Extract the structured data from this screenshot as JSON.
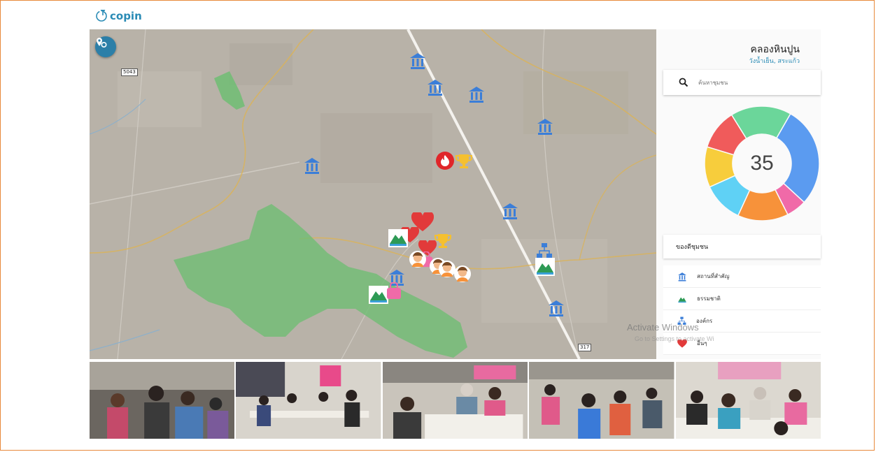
{
  "app": {
    "name": "copin"
  },
  "map": {
    "road_badges": [
      "5043",
      "317"
    ]
  },
  "panel": {
    "title": "คลองหินปูน",
    "subtitle": "วังน้ำเย็น, สระแก้ว",
    "search": {
      "placeholder": "ค้นหาชุมชน"
    },
    "donut": {
      "total": "35",
      "segments": [
        {
          "color": "#5b9bf0",
          "value": 10
        },
        {
          "color": "#f06aa8",
          "value": 2
        },
        {
          "color": "#f7923a",
          "value": 5
        },
        {
          "color": "#5fd1f5",
          "value": 4
        },
        {
          "color": "#f7cd3c",
          "value": 4
        },
        {
          "color": "#f05b5b",
          "value": 4
        },
        {
          "color": "#6bd69a",
          "value": 6
        }
      ]
    },
    "legend_title": "ของดีชุมชน",
    "legend": [
      {
        "label": "สถานที่สำคัญ",
        "icon": "building-icon",
        "color": "#3b7ed8"
      },
      {
        "label": "ธรรมชาติ",
        "icon": "mountain-icon",
        "color": "#2e9a55"
      },
      {
        "label": "องค์กร",
        "icon": "org-chart-icon",
        "color": "#3b7ed8"
      },
      {
        "label": "อื่นๆ",
        "icon": "heart-icon",
        "color": "#e23a3a"
      }
    ]
  },
  "watermark": {
    "line1": "Activate Windows",
    "line2": "Go to Settings to activate Wi"
  },
  "photos": {
    "count": 5
  }
}
